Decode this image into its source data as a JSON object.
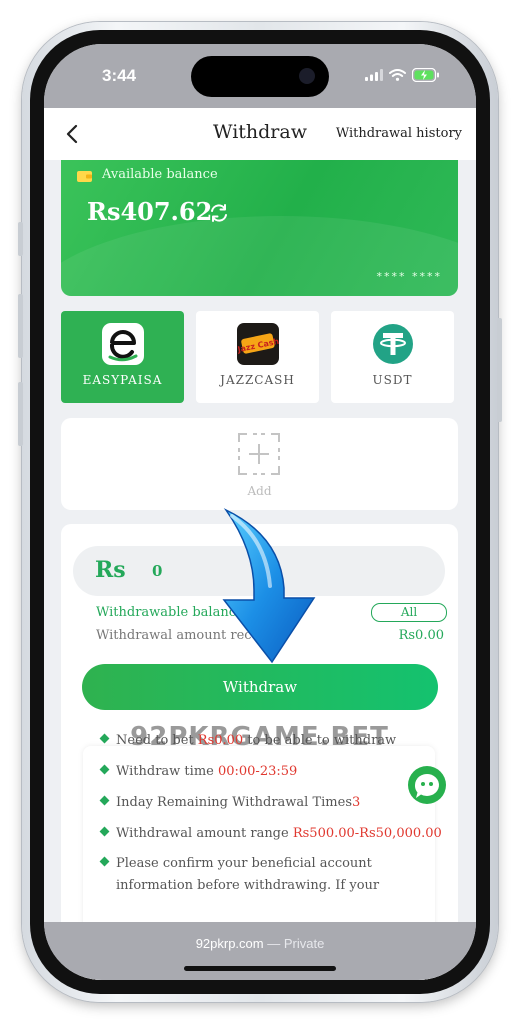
{
  "status_bar": {
    "time": "3:44",
    "icons": [
      "signal-icon",
      "wifi-icon",
      "battery-charging-icon"
    ]
  },
  "header": {
    "back_icon": "chevron-left-icon",
    "title": "Withdraw",
    "history_link": "Withdrawal history"
  },
  "balance_card": {
    "label": "Available balance",
    "amount": "Rs407.62",
    "card_number_masked": "****   ****"
  },
  "payment_methods": [
    {
      "label": "EASYPAISA",
      "active": true,
      "icon": "easypaisa-logo-icon"
    },
    {
      "label": "JAZZCASH",
      "active": false,
      "icon": "jazzcash-logo-icon",
      "logo_text": "Jazz Cash"
    },
    {
      "label": "USDT",
      "active": false,
      "icon": "tether-logo-icon"
    }
  ],
  "add_account": {
    "label": "Add"
  },
  "form": {
    "currency": "Rs",
    "amount_value": "0",
    "withdrawable_label": "Withdrawable balance",
    "all_label": "All",
    "received_label": "Withdrawal amount rece",
    "received_value": "Rs0.00",
    "withdraw_button": "Withdraw"
  },
  "watermark": "92PKRGAME.BET",
  "rules": [
    {
      "parts": [
        {
          "text": "Need to bet ",
          "red": false
        },
        {
          "text": "Rs0.00",
          "red": true
        },
        {
          "text": " to be able to withdraw",
          "red": false
        }
      ]
    },
    {
      "parts": [
        {
          "text": "Withdraw time ",
          "red": false
        },
        {
          "text": "00:00-23:59",
          "red": true
        }
      ]
    },
    {
      "parts": [
        {
          "text": "Inday Remaining Withdrawal Times",
          "red": false
        },
        {
          "text": "3",
          "red": true
        }
      ]
    },
    {
      "parts": [
        {
          "text": "Withdrawal amount range ",
          "red": false
        },
        {
          "text": "Rs500.00-Rs50,000.00",
          "red": true
        }
      ]
    },
    {
      "parts": [
        {
          "text": "Please confirm your beneficial account",
          "red": false
        }
      ]
    },
    {
      "parts": [
        {
          "text": "information before withdrawing. If your",
          "red": false
        }
      ]
    }
  ],
  "browser_bar": {
    "domain": "92pkrp.com",
    "separator": " — ",
    "mode": "Private"
  },
  "colors": {
    "green": "#24a85a",
    "card_green": "#2fb153",
    "red": "#e0382f",
    "status_gray": "#a9aab0"
  }
}
